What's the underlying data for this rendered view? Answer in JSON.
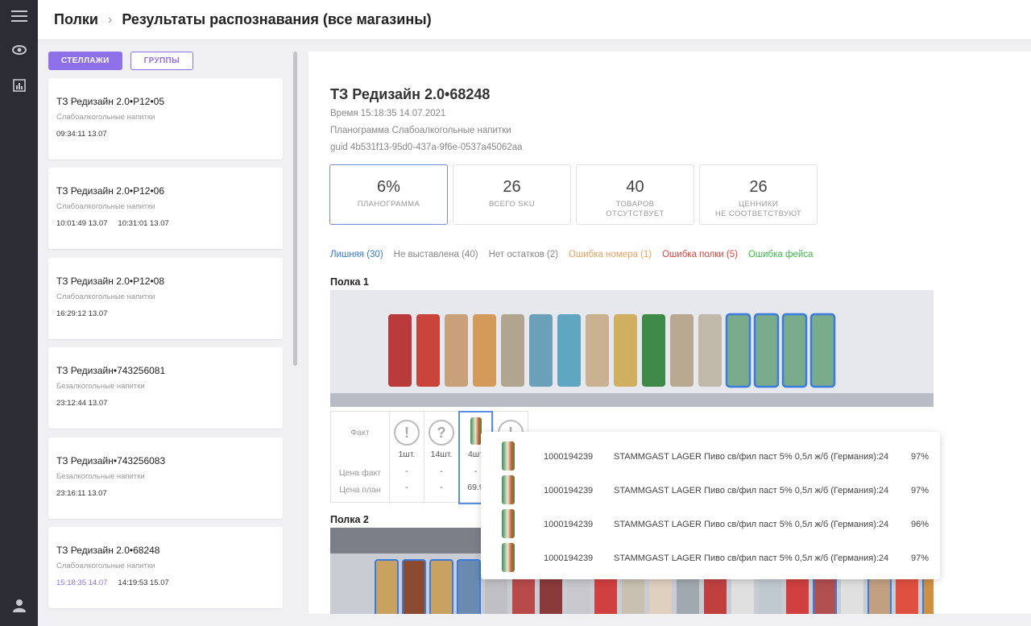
{
  "nav": {
    "menu_icon": "hamburger-icon",
    "eye_icon": "eye-icon",
    "chart_icon": "chart-icon",
    "user_icon": "user-icon"
  },
  "breadcrumb": {
    "root": "Полки",
    "separator": "›",
    "current": "Результаты распознавания (все магазины)"
  },
  "tabs": {
    "racks": "СТЕЛЛАЖИ",
    "groups": "ГРУППЫ"
  },
  "cards": [
    {
      "title": "ТЗ Редизайн 2.0•Р12•05",
      "sub": "Слабоалкогольные напитки",
      "times": [
        "09:34:11 13.07"
      ]
    },
    {
      "title": "ТЗ Редизайн 2.0•Р12•06",
      "sub": "Слабоалкогольные напитки",
      "times": [
        "10:01:49 13.07",
        "10:31:01 13.07"
      ]
    },
    {
      "title": "ТЗ Редизайн 2.0•Р12•08",
      "sub": "Слабоалкогольные напитки",
      "times": [
        "16:29:12 13.07"
      ]
    },
    {
      "title": "ТЗ Редизайн•743256081",
      "sub": "Безалкогольные напитки",
      "times": [
        "23:12:44 13.07"
      ]
    },
    {
      "title": "ТЗ Редизайн•743256083",
      "sub": "Безалкогольные напитки",
      "times": [
        "23:16:11 13.07"
      ]
    },
    {
      "title": "ТЗ Редизайн 2.0•68248",
      "sub": "Слабоалкогольные напитки",
      "times": [
        "15:18:35 14.07",
        "14:19:53 15.07"
      ]
    }
  ],
  "detail": {
    "title": "ТЗ Редизайн 2.0•68248",
    "time": "Время 15:18:35 14.07.2021",
    "planogram": "Планограмма Слабоалкогольные напитки",
    "guid": "guid 4b531f13-95d0-437a-9f6e-0537a45062aa"
  },
  "stats": [
    {
      "value": "6%",
      "label1": "ПЛАНОГРАММА",
      "label2": ""
    },
    {
      "value": "26",
      "label1": "ВСЕГО SKU",
      "label2": ""
    },
    {
      "value": "40",
      "label1": "ТОВАРОВ",
      "label2": "ОТСУТСТВУЕТ"
    },
    {
      "value": "26",
      "label1": "ЦЕННИКИ",
      "label2": "НЕ СООТВЕТСТВУЮТ"
    }
  ],
  "filters": [
    {
      "label": "Лишняя (30)",
      "color": "#3a7bd5"
    },
    {
      "label": "Не выставлена (40)",
      "color": "#888888"
    },
    {
      "label": "Нет остатков (2)",
      "color": "#888888"
    },
    {
      "label": "Ошибка номера (1)",
      "color": "#f0a060"
    },
    {
      "label": "Ошибка полки (5)",
      "color": "#e5413a"
    },
    {
      "label": "Ошибка фейса",
      "color": "#3dbb4c"
    }
  ],
  "shelf1": "Полка 1",
  "shelf2": "Полка 2",
  "table": {
    "fact": "Факт",
    "price_fact": "Цена факт",
    "price_plan": "Цена план",
    "cols": [
      {
        "icon": "!",
        "count": "1шт.",
        "pf": "-",
        "pp": "-"
      },
      {
        "icon": "?",
        "count": "14шт.",
        "pf": "-",
        "pp": "-"
      },
      {
        "icon": "can",
        "count": "4шт",
        "pf": "-",
        "pp": "69.9"
      },
      {
        "icon": "!",
        "count": "",
        "pf": "",
        "pp": ""
      }
    ]
  },
  "popup": [
    {
      "code": "1000194239",
      "name": "STAMMGAST LAGER Пиво св/фил паст 5% 0,5л ж/б (Германия):24",
      "pct": "97%"
    },
    {
      "code": "1000194239",
      "name": "STAMMGAST LAGER Пиво св/фил паст 5% 0,5л ж/б (Германия):24",
      "pct": "97%"
    },
    {
      "code": "1000194239",
      "name": "STAMMGAST LAGER Пиво св/фил паст 5% 0,5л ж/б (Германия):24",
      "pct": "96%"
    },
    {
      "code": "1000194239",
      "name": "STAMMGAST LAGER Пиво св/фил паст 5% 0,5л ж/б (Германия):24",
      "pct": "97%"
    }
  ]
}
